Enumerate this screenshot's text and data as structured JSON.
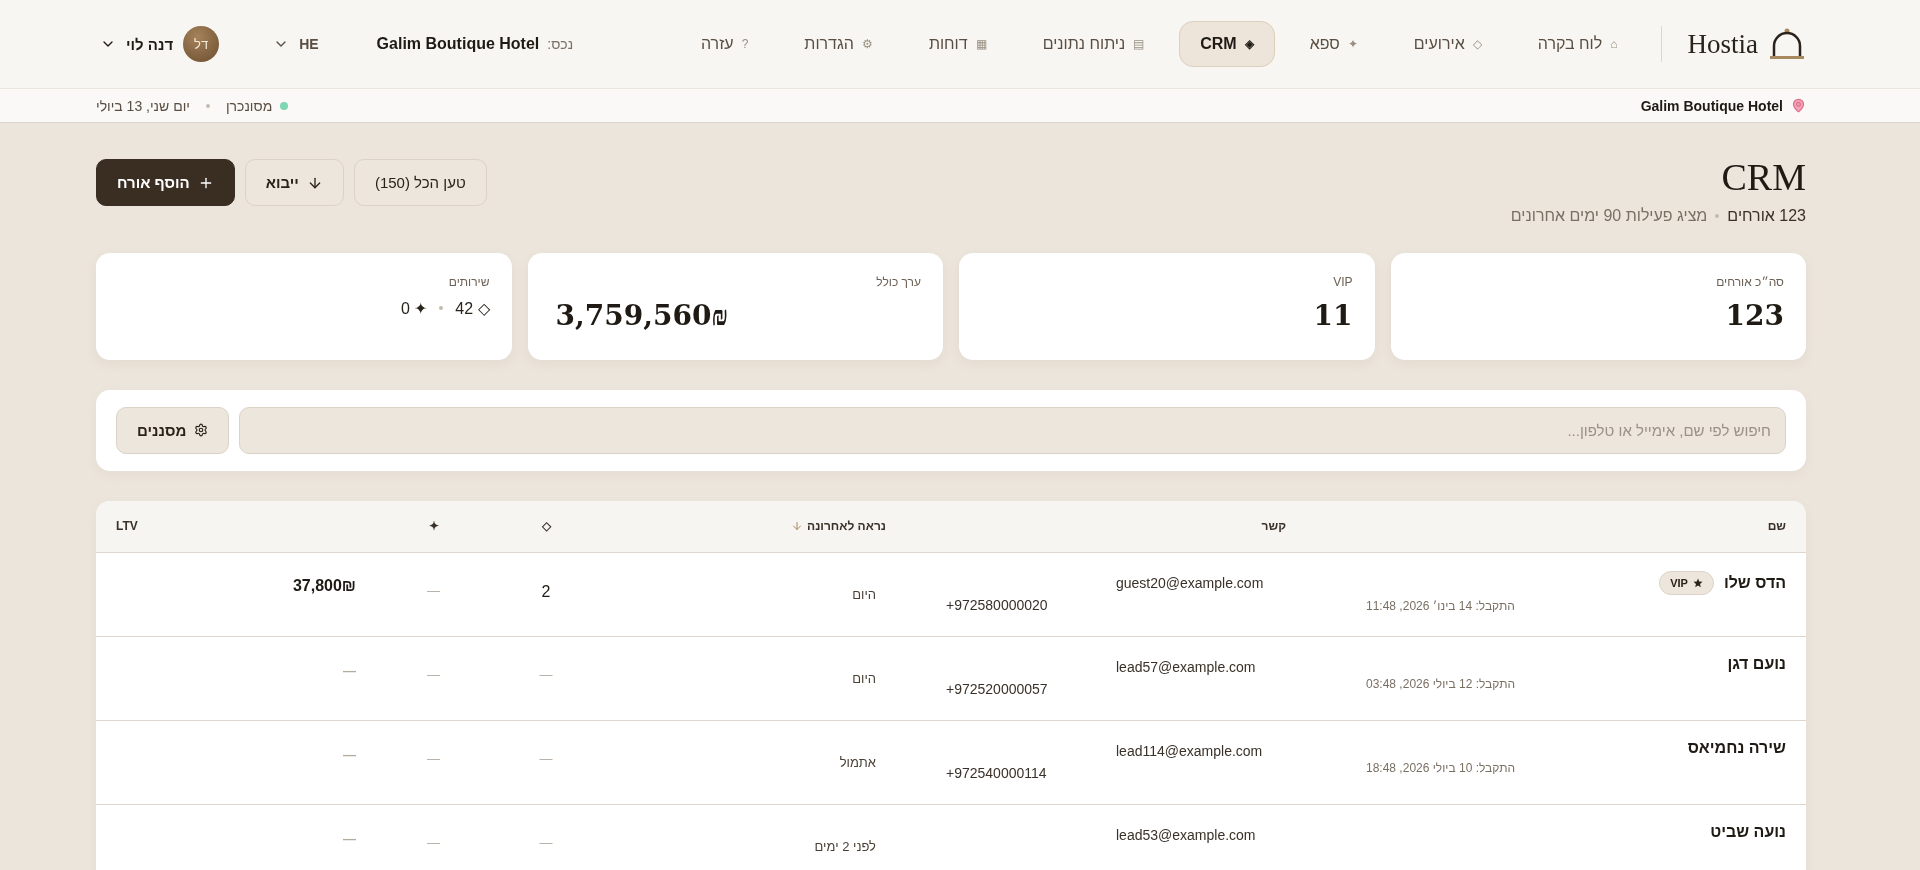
{
  "brand": "Hostia",
  "nav": {
    "items": [
      {
        "icon": "⌂",
        "label": "לוח בקרה",
        "selected": false
      },
      {
        "icon": "◇",
        "label": "אירועים",
        "selected": false
      },
      {
        "icon": "✦",
        "label": "ספא",
        "selected": false
      },
      {
        "icon": "◈",
        "label": "CRM",
        "selected": true
      },
      {
        "icon": "▤",
        "label": "ניתוח נתונים",
        "selected": false
      },
      {
        "icon": "▦",
        "label": "דוחות",
        "selected": false
      },
      {
        "icon": "⚙",
        "label": "הגדרות",
        "selected": false
      },
      {
        "icon": "?",
        "label": "עזרה",
        "selected": false
      }
    ]
  },
  "property": {
    "label": "נכס:",
    "value": "Galim Boutique Hotel"
  },
  "language": "HE",
  "user": {
    "initials": "דל",
    "name": "דנה לוי"
  },
  "subbar": {
    "location": "Galim Boutique Hotel",
    "sync": "מסונכרן",
    "date": "יום שני, 13 ביולי"
  },
  "header": {
    "title": "CRM",
    "count": "123 אורחים",
    "subtitle": "מציג פעילות 90 ימים אחרונים",
    "buttons": [
      {
        "kind": "plain",
        "label": "טען הכל (150)"
      },
      {
        "kind": "import",
        "label": "ייבוא"
      },
      {
        "kind": "primary",
        "label": "הוסף אורח"
      }
    ]
  },
  "stats": [
    {
      "kind": "number",
      "label": "סה״כ אורחים",
      "value": "123"
    },
    {
      "kind": "number",
      "label": "VIP",
      "value": "11"
    },
    {
      "kind": "money",
      "label": "ערך כולל",
      "value": "3,759,560₪"
    },
    {
      "kind": "services",
      "label": "שירותים",
      "services": [
        {
          "icon": "◇",
          "count": "42"
        },
        {
          "icon": "✦",
          "count": "0"
        }
      ]
    }
  ],
  "search": {
    "placeholder": "חיפוש לפי שם, אימייל או טלפון...",
    "filter_label": "מסננים"
  },
  "table": {
    "columns": [
      {
        "label": "שם",
        "sorted": false
      },
      {
        "label": "קשר",
        "sorted": false
      },
      {
        "label": "נראה לאחרונה",
        "sorted": true
      },
      {
        "label": "◇",
        "sorted": false
      },
      {
        "label": "✦",
        "sorted": false
      },
      {
        "label": "LTV",
        "sorted": false
      }
    ],
    "rows": [
      {
        "name": "הדס שלו",
        "badge": "VIP",
        "received": "התקבל: 14 בינו׳ 2026, 11:48",
        "email": "guest20@example.com",
        "phone": "+972580000020",
        "last_seen": "היום",
        "column_4": "2",
        "column_5": "—",
        "ltv": "37,800₪"
      },
      {
        "name": "נועם דגן",
        "received": "התקבל: 12 ביולי 2026, 03:48",
        "email": "lead57@example.com",
        "phone": "+972520000057",
        "last_seen": "היום",
        "column_4": "—",
        "column_5": "—",
        "ltv": "—"
      },
      {
        "name": "שירה נחמיאס",
        "received": "התקבל: 10 ביולי 2026, 18:48",
        "email": "lead114@example.com",
        "phone": "+972540000114",
        "last_seen": "אתמול",
        "column_4": "—",
        "column_5": "—",
        "ltv": "—"
      },
      {
        "name": "נועה שביט",
        "email": "lead53@example.com",
        "last_seen": "לפני 2 ימים",
        "column_4": "—",
        "column_5": "—",
        "ltv": "—"
      }
    ]
  }
}
